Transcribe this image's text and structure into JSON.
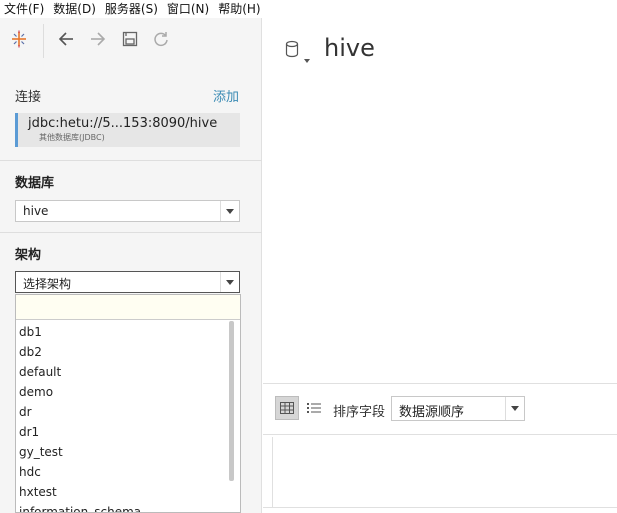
{
  "menu": [
    {
      "label": "文件(F)"
    },
    {
      "label": "数据(D)"
    },
    {
      "label": "服务器(S)"
    },
    {
      "label": "窗口(N)"
    },
    {
      "label": "帮助(H)"
    }
  ],
  "toolbar": {
    "icons": [
      "tableau-logo-icon",
      "back-arrow-icon",
      "forward-arrow-icon",
      "save-icon",
      "refresh-icon"
    ]
  },
  "sidebar": {
    "connection_label": "连接",
    "add_label": "添加",
    "connection": {
      "name": "jdbc:hetu://5...153:8090/hive",
      "type": "其他数据库(JDBC)"
    },
    "database_label": "数据库",
    "database_value": "hive",
    "schema_label": "架构",
    "schema_placeholder": "选择架构",
    "schema_options": [
      "db1",
      "db2",
      "default",
      "demo",
      "dr",
      "dr1",
      "gy_test",
      "hdc",
      "hxtest",
      "information_schema"
    ]
  },
  "main": {
    "title": "hive",
    "sort_label": "排序字段",
    "sort_value": "数据源顺序"
  },
  "colors": {
    "accent_link": "#3b8bb4",
    "connection_bar": "#5b9bd5",
    "sidebar_bg": "#f5f5f5"
  }
}
